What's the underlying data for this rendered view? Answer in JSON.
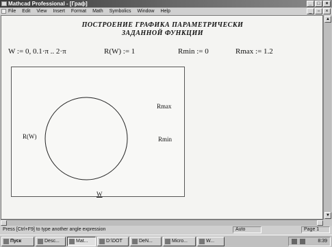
{
  "window": {
    "title": "Mathcad Professional - [Граф]"
  },
  "menu": [
    "File",
    "Edit",
    "View",
    "Insert",
    "Format",
    "Math",
    "Symbolics",
    "Window",
    "Help"
  ],
  "heading": {
    "line1": "ПОСТРОЕНИЕ ГРАФИКА ПАРАМЕТРИЧЕСКИ",
    "line2": "ЗАДАННОЙ ФУНКЦИИ"
  },
  "expressions": {
    "range": "W := 0, 0.1·π .. 2·π",
    "func": "R(W) := 1",
    "rmin": "Rmin := 0",
    "rmax": "Rmax := 1.2"
  },
  "plot": {
    "type": "polar",
    "rmax_label": "Rmax",
    "rmin_label": "Rmin",
    "y_label": "R(W)",
    "x_label": "W",
    "radius": 1,
    "r_range": [
      0,
      1.2
    ]
  },
  "status": {
    "hint": "Press [Ctrl+F9] to type another angle expression",
    "mode": "Auto",
    "page": "Page 1"
  },
  "taskbar": {
    "start": "Пуск",
    "items": [
      "Desc...",
      "Mat...",
      "D:\\DOT",
      "DeN...",
      "Micro...",
      "W..."
    ],
    "clock": "8:39"
  }
}
